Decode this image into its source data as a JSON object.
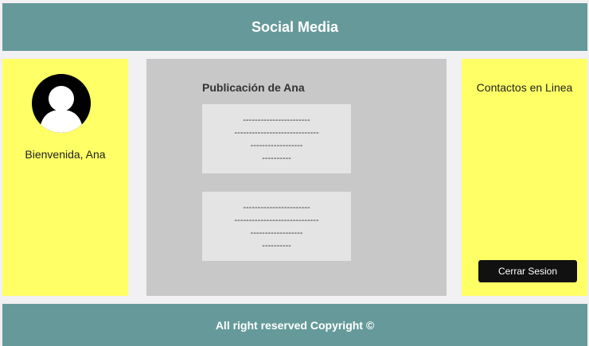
{
  "header": {
    "title": "Social Media"
  },
  "left_panel": {
    "welcome_text": "Bienvenida, Ana",
    "avatar_icon": "user-avatar-icon"
  },
  "center_panel": {
    "post_title": "Publicación de Ana",
    "posts": [
      {
        "lines": [
          "-----------------------",
          "-----------------------------",
          "------------------",
          "----------"
        ]
      },
      {
        "lines": [
          "-----------------------",
          "-----------------------------",
          "------------------",
          "----------"
        ]
      }
    ]
  },
  "right_panel": {
    "contacts_title": "Contactos en Linea",
    "logout_label": "Cerrar Sesion"
  },
  "footer": {
    "text": "All right reserved Copyright ©"
  },
  "colors": {
    "teal": "#669a9a",
    "yellow": "#ffff66",
    "gray_panel": "#c8c8c8",
    "post_bg": "#e4e4e4",
    "button": "#111111"
  }
}
